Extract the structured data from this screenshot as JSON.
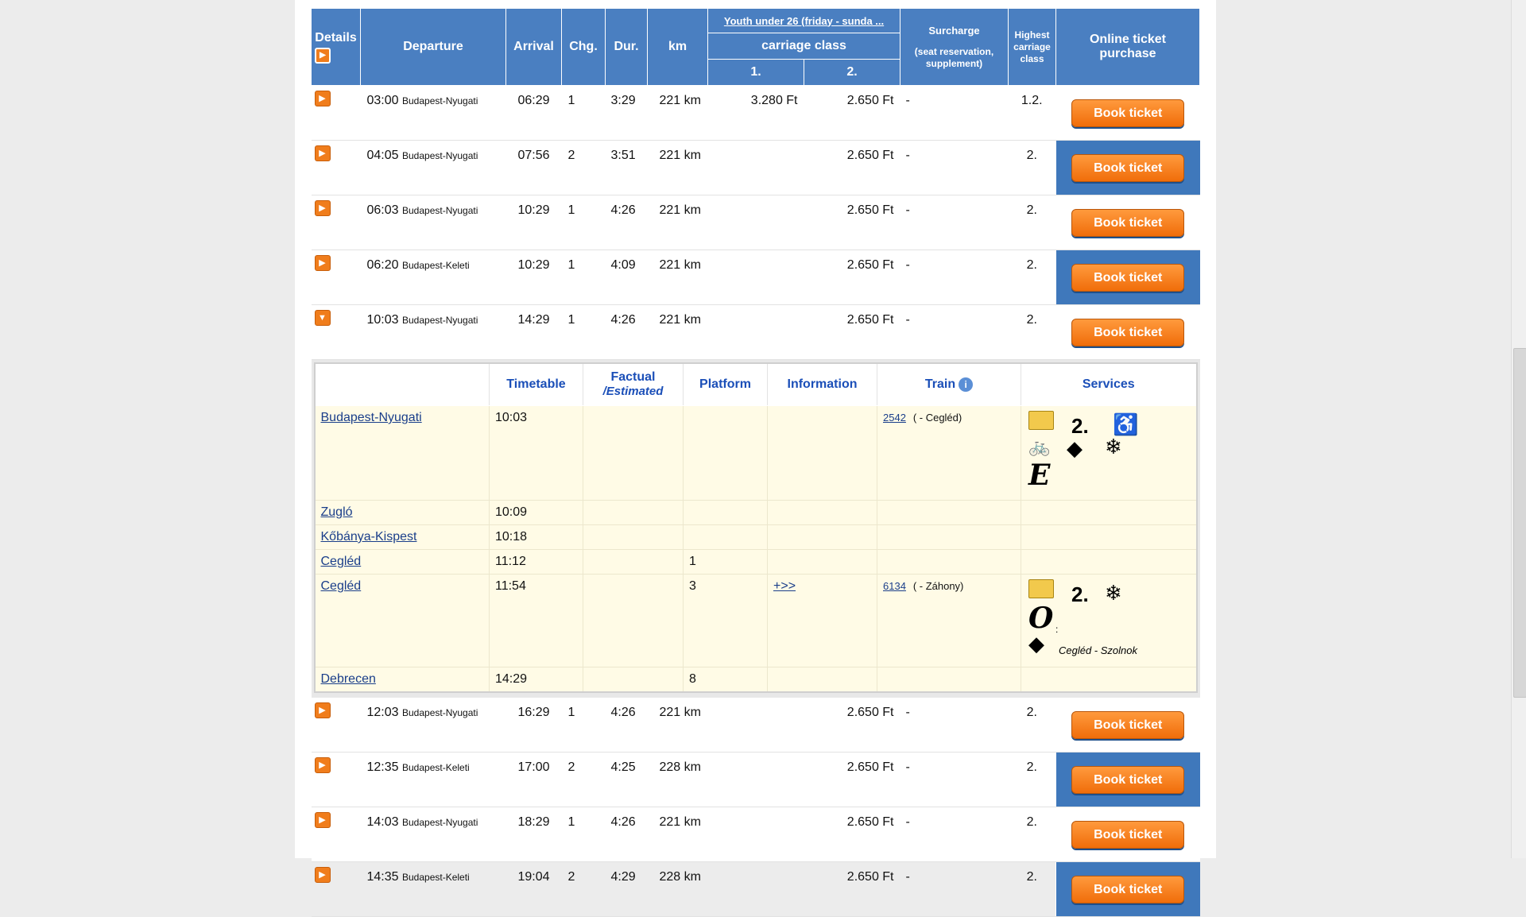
{
  "header": {
    "details": "Details",
    "departure": "Departure",
    "arrival": "Arrival",
    "chg": "Chg.",
    "dur": "Dur.",
    "km": "km",
    "youth_link": "Youth under 26 (friday - sunda ...",
    "carriage_class": "carriage class",
    "class1": "1.",
    "class2": "2.",
    "surcharge_title": "Surcharge",
    "surcharge_sub": "(seat reservation, supplement)",
    "highest_class": "Highest carriage class",
    "online_purchase": "Online ticket purchase"
  },
  "book_label": "Book ticket",
  "connections_before": [
    {
      "time": "03:00",
      "station": "Budapest-Nyugati",
      "arrival": "06:29",
      "chg": "1",
      "dur": "3:29",
      "km": "221 km",
      "price1": "3.280 Ft",
      "price2": "2.650 Ft",
      "surcharge": "-",
      "highest": "1.2."
    },
    {
      "time": "04:05",
      "station": "Budapest-Nyugati",
      "arrival": "07:56",
      "chg": "2",
      "dur": "3:51",
      "km": "221 km",
      "price1": "",
      "price2": "2.650 Ft",
      "surcharge": "-",
      "highest": "2."
    },
    {
      "time": "06:03",
      "station": "Budapest-Nyugati",
      "arrival": "10:29",
      "chg": "1",
      "dur": "4:26",
      "km": "221 km",
      "price1": "",
      "price2": "2.650 Ft",
      "surcharge": "-",
      "highest": "2."
    },
    {
      "time": "06:20",
      "station": "Budapest-Keleti",
      "arrival": "10:29",
      "chg": "1",
      "dur": "4:09",
      "km": "221 km",
      "price1": "",
      "price2": "2.650 Ft",
      "surcharge": "-",
      "highest": "2."
    },
    {
      "time": "10:03",
      "station": "Budapest-Nyugati",
      "arrival": "14:29",
      "chg": "1",
      "dur": "4:26",
      "km": "221 km",
      "price1": "",
      "price2": "2.650 Ft",
      "surcharge": "-",
      "highest": "2."
    }
  ],
  "detail": {
    "headers": {
      "timetable": "Timetable",
      "factual": "Factual",
      "estimated": "/Estimated",
      "platform": "Platform",
      "information": "Information",
      "train": "Train",
      "services": "Services"
    },
    "stops": [
      {
        "station": "Budapest-Nyugati",
        "time": "10:03",
        "platform": "",
        "info": "",
        "train_no": "2542",
        "train_dest": "( - Cegléd)",
        "service_set": "a"
      },
      {
        "station": "Zugló",
        "time": "10:09",
        "platform": "",
        "info": "",
        "train_no": "",
        "train_dest": "",
        "service_set": ""
      },
      {
        "station": "Kőbánya-Kispest",
        "time": "10:18",
        "platform": "",
        "info": "",
        "train_no": "",
        "train_dest": "",
        "service_set": ""
      },
      {
        "station": "Cegléd",
        "time": "11:12",
        "platform": "1",
        "info": "",
        "train_no": "",
        "train_dest": "",
        "service_set": ""
      },
      {
        "station": "Cegléd",
        "time": "11:54",
        "platform": "3",
        "info": "+>>",
        "train_no": "6134",
        "train_dest": "( - Záhony)",
        "service_set": "b"
      },
      {
        "station": "Debrecen",
        "time": "14:29",
        "platform": "8",
        "info": "",
        "train_no": "",
        "train_dest": "",
        "service_set": ""
      }
    ],
    "service_icons": {
      "class_label": "2.",
      "a_bigletter": "E",
      "b_bigletter": "O",
      "b_colon": ":",
      "b_note": "Cegléd - Szolnok"
    }
  },
  "connections_after": [
    {
      "time": "12:03",
      "station": "Budapest-Nyugati",
      "arrival": "16:29",
      "chg": "1",
      "dur": "4:26",
      "km": "221 km",
      "price1": "",
      "price2": "2.650 Ft",
      "surcharge": "-",
      "highest": "2."
    },
    {
      "time": "12:35",
      "station": "Budapest-Keleti",
      "arrival": "17:00",
      "chg": "2",
      "dur": "4:25",
      "km": "228 km",
      "price1": "",
      "price2": "2.650 Ft",
      "surcharge": "-",
      "highest": "2."
    },
    {
      "time": "14:03",
      "station": "Budapest-Nyugati",
      "arrival": "18:29",
      "chg": "1",
      "dur": "4:26",
      "km": "221 km",
      "price1": "",
      "price2": "2.650 Ft",
      "surcharge": "-",
      "highest": "2."
    },
    {
      "time": "14:35",
      "station": "Budapest-Keleti",
      "arrival": "19:04",
      "chg": "2",
      "dur": "4:29",
      "km": "228 km",
      "price1": "",
      "price2": "2.650 Ft",
      "surcharge": "-",
      "highest": "2."
    }
  ],
  "colors": {
    "header_blue": "#4a7fc1",
    "book_orange": "#f07d1c",
    "link_blue": "#1b4fb8",
    "detail_bg": "#fffbe6"
  }
}
